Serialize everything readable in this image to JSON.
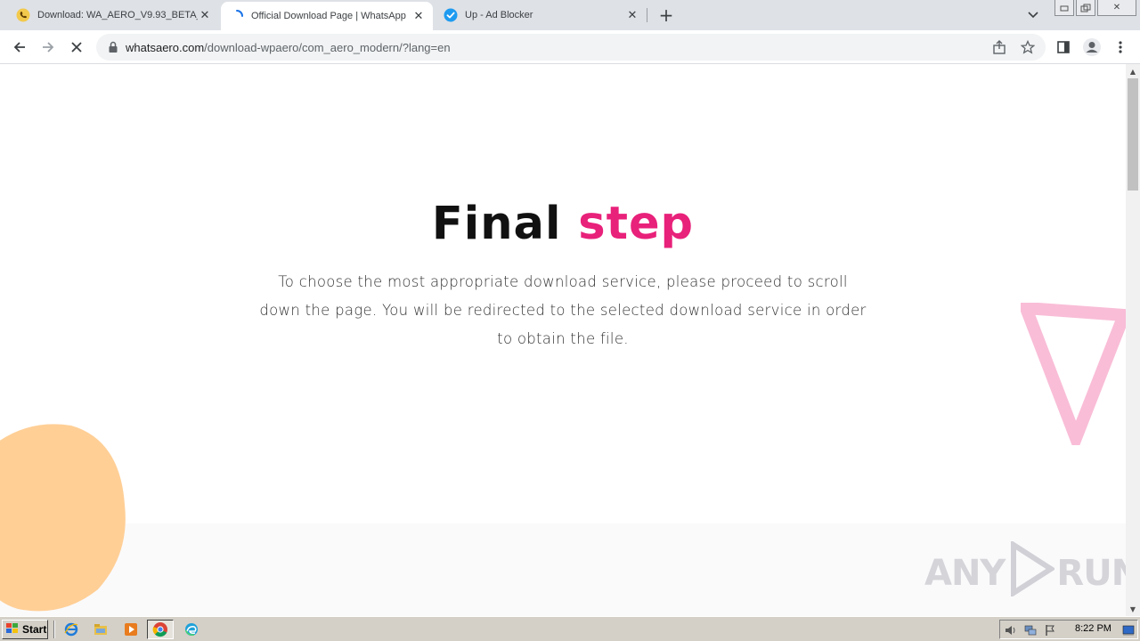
{
  "browser": {
    "tabs": [
      {
        "title": "Download: WA_AERO_V9.93_BETA_",
        "favicon": "whatsapp-phone-icon",
        "active": false
      },
      {
        "title": "Official Download Page | WhatsApp",
        "favicon": "loading-spinner-icon",
        "active": true
      },
      {
        "title": "Up - Ad Blocker",
        "favicon": "checkmark-badge-icon",
        "active": false
      }
    ],
    "url_host": "whatsaero.com",
    "url_path": "/download-wpaero/com_aero_modern/?lang=en"
  },
  "page": {
    "heading_word1": "Final",
    "heading_word2": "step",
    "description": "To choose the most appropriate download service, please proceed to scroll down the page. You will be redirected to the selected download service in order to obtain the file.",
    "watermark_left": "ANY",
    "watermark_right": "RUN"
  },
  "colors": {
    "accent": "#e8217a",
    "blob": "#ffcf96",
    "triangle": "#f8b6d3"
  },
  "taskbar": {
    "start_label": "Start",
    "clock": "8:22 PM"
  }
}
